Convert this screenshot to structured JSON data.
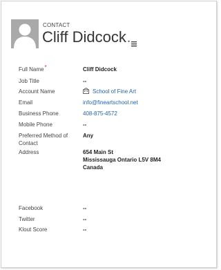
{
  "header": {
    "entity_label": "CONTACT",
    "contact_name": "Cliff Didcock"
  },
  "fields": {
    "full_name": {
      "label": "Full Name",
      "required": "*",
      "value": "Cliff Didcock"
    },
    "job_title": {
      "label": "Job Title",
      "value": "--"
    },
    "account_name": {
      "label": "Account Name",
      "value": "School of Fine Art",
      "icon": "account-icon"
    },
    "email": {
      "label": "Email",
      "value": "info@fineartschool.net"
    },
    "business_phone": {
      "label": "Business Phone",
      "value": "408-875-4572"
    },
    "mobile_phone": {
      "label": "Mobile Phone",
      "value": "--"
    },
    "preferred_contact": {
      "label_line1": "Preferred Method of",
      "label_line2": "Contact",
      "value": "Any"
    },
    "address": {
      "label": "Address",
      "line1": "654 Main St",
      "line2": "Mississauga Ontario L5V 8M4",
      "line3": "Canada"
    },
    "facebook": {
      "label": "Facebook",
      "value": "--"
    },
    "twitter": {
      "label": "Twitter",
      "value": "--"
    },
    "klout_score": {
      "label": "Klout Score",
      "value": "--"
    }
  },
  "colors": {
    "link": "#1e63b0",
    "required": "#dd2222",
    "avatar_bg": "#a9a9a9"
  }
}
